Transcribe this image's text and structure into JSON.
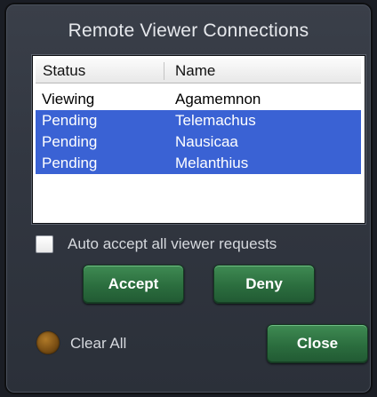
{
  "window": {
    "title": "Remote Viewer Connections"
  },
  "table": {
    "columns": [
      "Status",
      "Name"
    ],
    "rows": [
      {
        "status": "Viewing",
        "name": "Agamemnon",
        "selected": false
      },
      {
        "status": "Pending",
        "name": "Telemachus",
        "selected": true
      },
      {
        "status": "Pending",
        "name": "Nausicaa",
        "selected": true
      },
      {
        "status": "Pending",
        "name": "Melanthius",
        "selected": true
      }
    ]
  },
  "auto_accept": {
    "label": "Auto accept all viewer requests",
    "checked": false
  },
  "buttons": {
    "accept": "Accept",
    "deny": "Deny",
    "close": "Close"
  },
  "clear_all": {
    "label": "Clear All"
  },
  "colors": {
    "selection": "#3a62d4",
    "button_green": "#2b6d3e",
    "panel": "#323741"
  }
}
